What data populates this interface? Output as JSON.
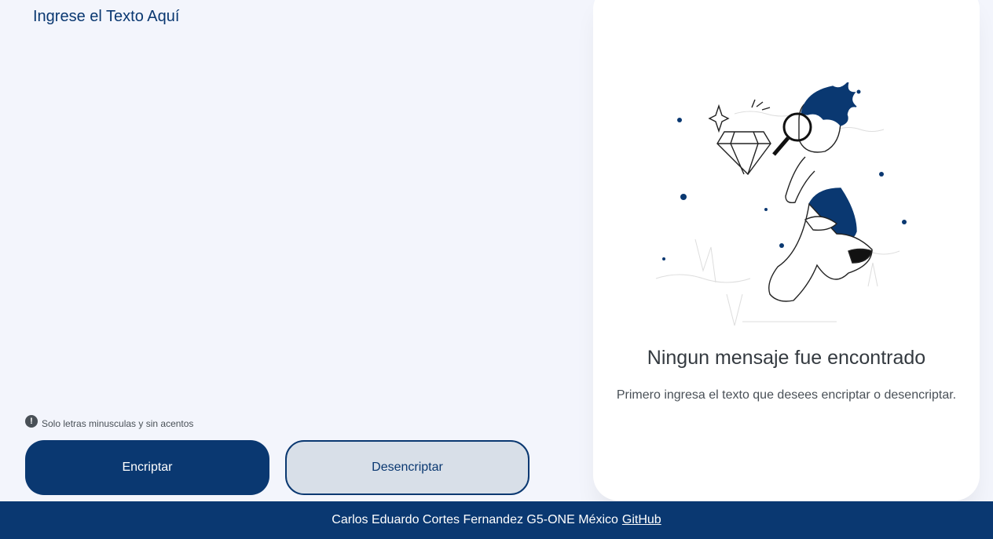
{
  "input": {
    "placeholder": "Ingrese el Texto Aquí"
  },
  "hint": {
    "icon": "exclamation-circle-icon",
    "text": "Solo letras minusculas y sin acentos"
  },
  "buttons": {
    "encrypt_label": "Encriptar",
    "decrypt_label": "Desencriptar"
  },
  "output": {
    "title": "Ningun mensaje fue encontrado",
    "subtitle": "Primero ingresa el texto que desees encriptar o desencriptar."
  },
  "footer": {
    "text": "Carlos Eduardo Cortes Fernandez G5-ONE México",
    "link_label": "GitHub"
  },
  "colors": {
    "primary": "#0a3871",
    "background": "#f3f5fc",
    "panel": "#ffffff",
    "secondary_button": "#d8dfe8"
  }
}
